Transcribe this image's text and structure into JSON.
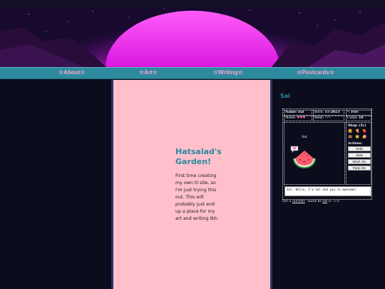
{
  "nav": {
    "items": [
      {
        "label": "☆About☆"
      },
      {
        "label": "☆Art☆"
      },
      {
        "label": "☆Writing☆"
      },
      {
        "label": "☆Postcards☆"
      }
    ]
  },
  "main": {
    "title": "Hatsalad's Garden!",
    "body": "First time creating my own lil site, so I'm just trying this out. This will probably just end up a place for my art and writing tbh."
  },
  "pet": {
    "section_title": "Sal",
    "name_label": "Name:",
    "name_value": "Sal",
    "born_label": "Born:",
    "born_value": "11-2023",
    "type_label": "*:",
    "type_value": "Fire",
    "mood_label": "Mood:",
    "mood_value": "♥♥♥",
    "belly_label": "Belly:",
    "belly_value": "•••",
    "coins_label": "Coins:",
    "coins_value": "10",
    "stage_name": "Sal",
    "speech_icon": "heart-bubble-icon",
    "sprite_icon": "watermelon-slice-icon",
    "shop_label": "Shop: (5c)",
    "shop_items": [
      "🍔",
      "🍕",
      "🍓",
      "🍩",
      "🌟",
      "🍰"
    ],
    "actions_label": "Actions:",
    "actions": [
      "Hello",
      "Slots",
      "Wash 10c",
      "Party 20c"
    ],
    "chat": "Sal: Hello, I'm Sal and you're awesome!",
    "credit_prefix": "GET A",
    "credit_link": "GIFYPET",
    "credit_middle": "- MADE BY",
    "credit_author": "ME",
    "credit_suffix": "(S - 0.1)"
  },
  "colors": {
    "accent": "#2a8aa0",
    "nav_bg": "#2e8a9e",
    "nav_text": "#f7a8d0",
    "main_bg": "#ffc0cb",
    "page_bg": "#0b0d1d"
  }
}
